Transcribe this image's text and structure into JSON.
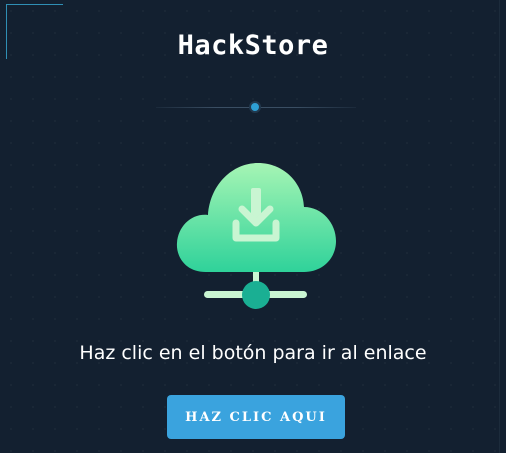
{
  "header": {
    "title": "HackStore"
  },
  "illustration": {
    "icon": "cloud-download-network-icon",
    "colors": {
      "cloud_top": "#a6f5b4",
      "cloud_bottom": "#2fd29a",
      "node": "#1aaf93",
      "lines": "#c9f5d2"
    }
  },
  "main": {
    "message": "Haz clic en el botón para ir al enlace",
    "button_label": "HAZ CLIC AQUI"
  },
  "colors": {
    "background": "#132030",
    "accent": "#3aa3de",
    "divider_dot": "#2e9fd4"
  }
}
